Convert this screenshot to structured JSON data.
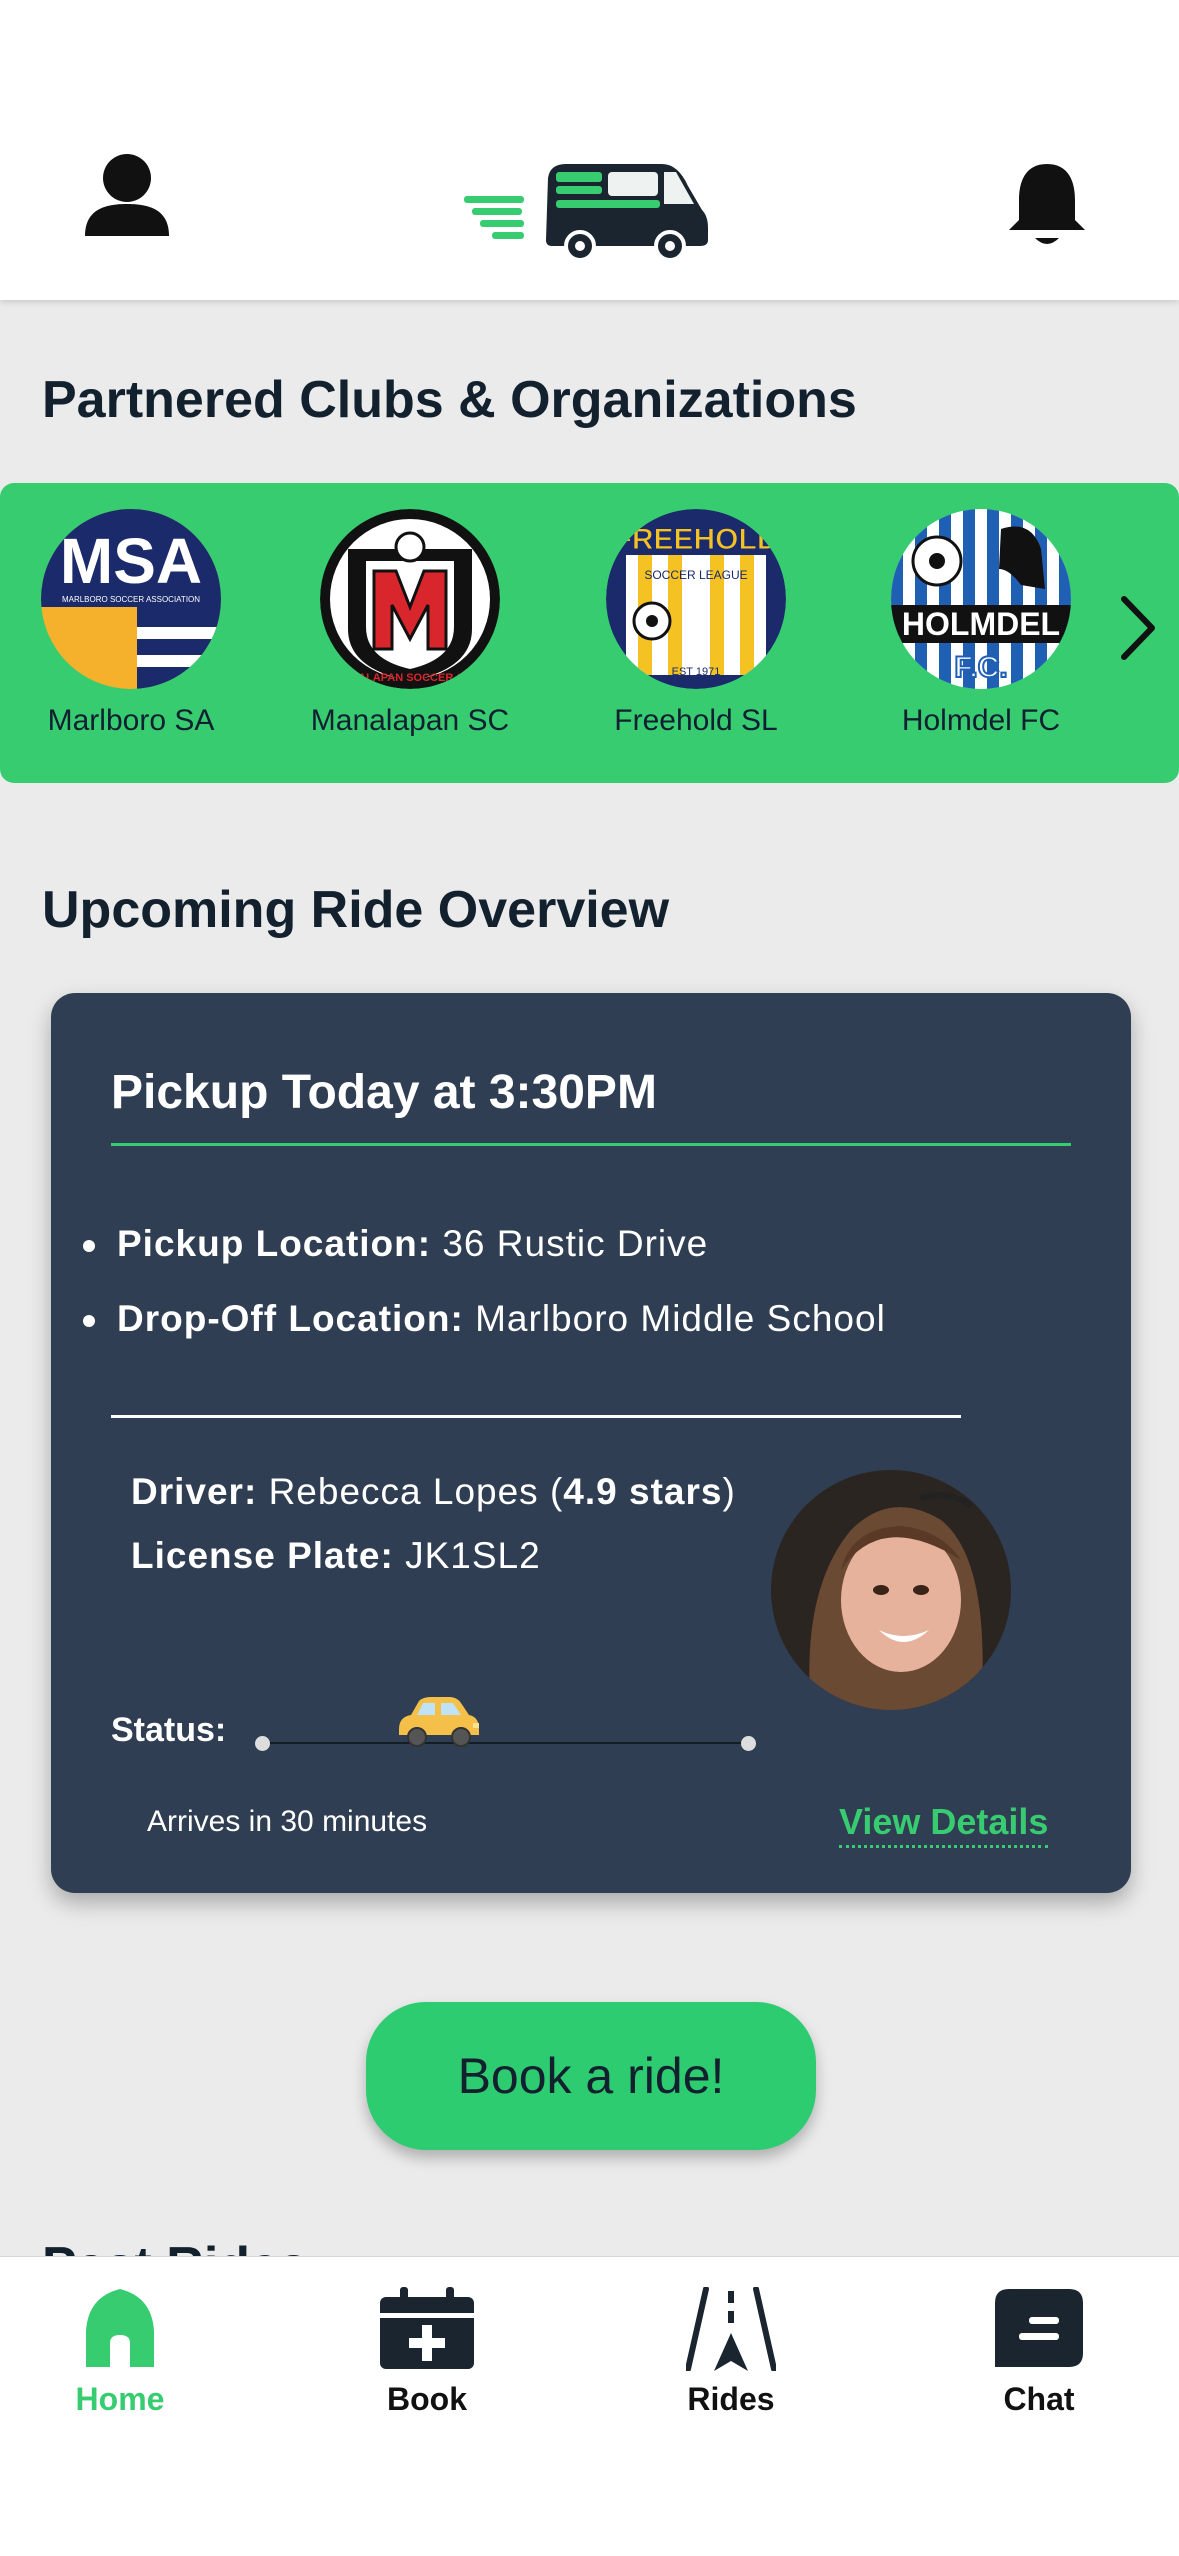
{
  "header": {
    "profile_icon": "person-icon",
    "logo_icon": "speeding-van-logo",
    "notification_icon": "bell-icon"
  },
  "clubs": {
    "title": "Partnered Clubs & Organizations",
    "items": [
      {
        "name": "Marlboro SA",
        "logo_text": "MSA",
        "logo_subtext": "MARLBORO SOCCER ASSOCIATION"
      },
      {
        "name": "Manalapan SC",
        "logo_text": "M",
        "logo_subtext": "MANALAPAN SOCCER CLUB"
      },
      {
        "name": "Freehold SL",
        "logo_text": "FREEHOLD",
        "logo_subtext": "SOCCER LEAGUE",
        "logo_extra": "EST 1971"
      },
      {
        "name": "Holmdel FC",
        "logo_text": "HOLMDEL",
        "logo_subtext": "F.C."
      }
    ],
    "next_icon": "chevron-right-icon"
  },
  "upcoming": {
    "title": "Upcoming Ride Overview",
    "pickup_title": "Pickup Today at 3:30PM",
    "pickup_label": "Pickup Location:",
    "pickup_value": "36 Rustic Drive",
    "dropoff_label": "Drop-Off Location:",
    "dropoff_value": "Marlboro Middle School",
    "driver_label": "Driver:",
    "driver_name": "Rebecca Lopes (",
    "driver_rating": "4.9 stars",
    "driver_close": ")",
    "plate_label": "License Plate:",
    "plate_value": "JK1SL2",
    "status_label": "Status:",
    "status_progress": 0.36,
    "arrival_text": "Arrives in 30 minutes",
    "view_details": "View Details"
  },
  "book_button": "Book a ride!",
  "past_rides_title": "Past Rides",
  "tabs": [
    {
      "label": "Home",
      "icon": "home-icon",
      "active": true
    },
    {
      "label": "Book",
      "icon": "calendar-plus-icon",
      "active": false
    },
    {
      "label": "Rides",
      "icon": "road-navigation-icon",
      "active": false
    },
    {
      "label": "Chat",
      "icon": "chat-bubble-icon",
      "active": false
    }
  ],
  "colors": {
    "accent": "#38cc71",
    "card": "#2f3e52",
    "background": "#ebebeb",
    "text_dark": "#13212f"
  }
}
